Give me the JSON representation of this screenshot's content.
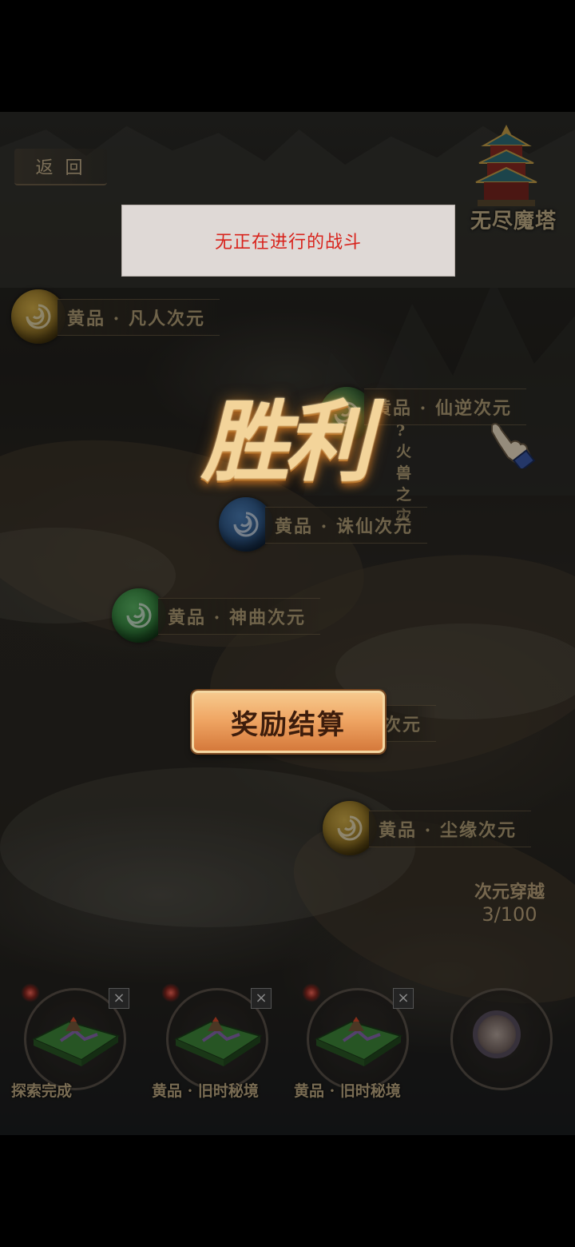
{
  "header": {
    "back_label": "返 回",
    "tower_label": "无尽魔塔"
  },
  "toast": {
    "message": "无正在进行的战斗"
  },
  "nodes": [
    {
      "label": "黄品 · 凡人次元",
      "orb_color": "#b58b2b"
    },
    {
      "label": "黄品 · 仙逆次元",
      "sub": "? 火兽之灾",
      "orb_color": "#3d6b3b"
    },
    {
      "label": "黄品 · 诛仙次元",
      "orb_color": "#2a4f7c"
    },
    {
      "label": "黄品 · 神曲次元",
      "orb_color": "#2f7a3a"
    },
    {
      "label": "次元",
      "orb_color": "#6a6a3a"
    },
    {
      "label": "黄品 · 尘缘次元",
      "orb_color": "#a58426"
    }
  ],
  "overlay": {
    "victory": "胜利",
    "reward_button": "奖励结算"
  },
  "progress": {
    "title": "次元穿越",
    "value": "3/100"
  },
  "slots": [
    {
      "label": "探索完成",
      "close": "×"
    },
    {
      "label": "黄品 · 旧时秘境",
      "close": "×"
    },
    {
      "label": "黄品 · 旧时秘境",
      "close": "×"
    }
  ],
  "colors": {
    "accent_gold": "#c7b48c",
    "toast_text": "#d8231c",
    "button_orange": "#f0a765"
  }
}
